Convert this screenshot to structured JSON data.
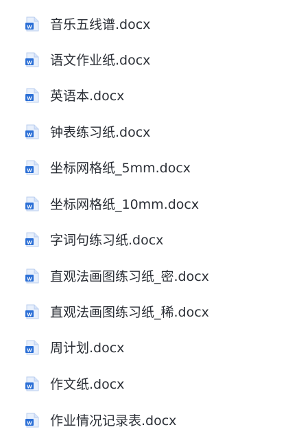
{
  "files": [
    {
      "name": "音乐五线谱.docx",
      "icon": "word-doc-icon"
    },
    {
      "name": "语文作业纸.docx",
      "icon": "word-doc-icon"
    },
    {
      "name": "英语本.docx",
      "icon": "word-doc-icon"
    },
    {
      "name": "钟表练习纸.docx",
      "icon": "word-doc-icon"
    },
    {
      "name": "坐标网格纸_5mm.docx",
      "icon": "word-doc-icon"
    },
    {
      "name": "坐标网格纸_10mm.docx",
      "icon": "word-doc-icon"
    },
    {
      "name": "字词句练习纸.docx",
      "icon": "word-doc-icon"
    },
    {
      "name": "直观法画图练习纸_密.docx",
      "icon": "word-doc-icon"
    },
    {
      "name": "直观法画图练习纸_稀.docx",
      "icon": "word-doc-icon"
    },
    {
      "name": "周计划.docx",
      "icon": "word-doc-icon"
    },
    {
      "name": "作文纸.docx",
      "icon": "word-doc-icon"
    },
    {
      "name": "作业情况记录表.docx",
      "icon": "word-doc-icon"
    }
  ],
  "colors": {
    "icon_blue": "#2b6fd6",
    "icon_light": "#e8f0fc",
    "text": "#2b2f36"
  }
}
